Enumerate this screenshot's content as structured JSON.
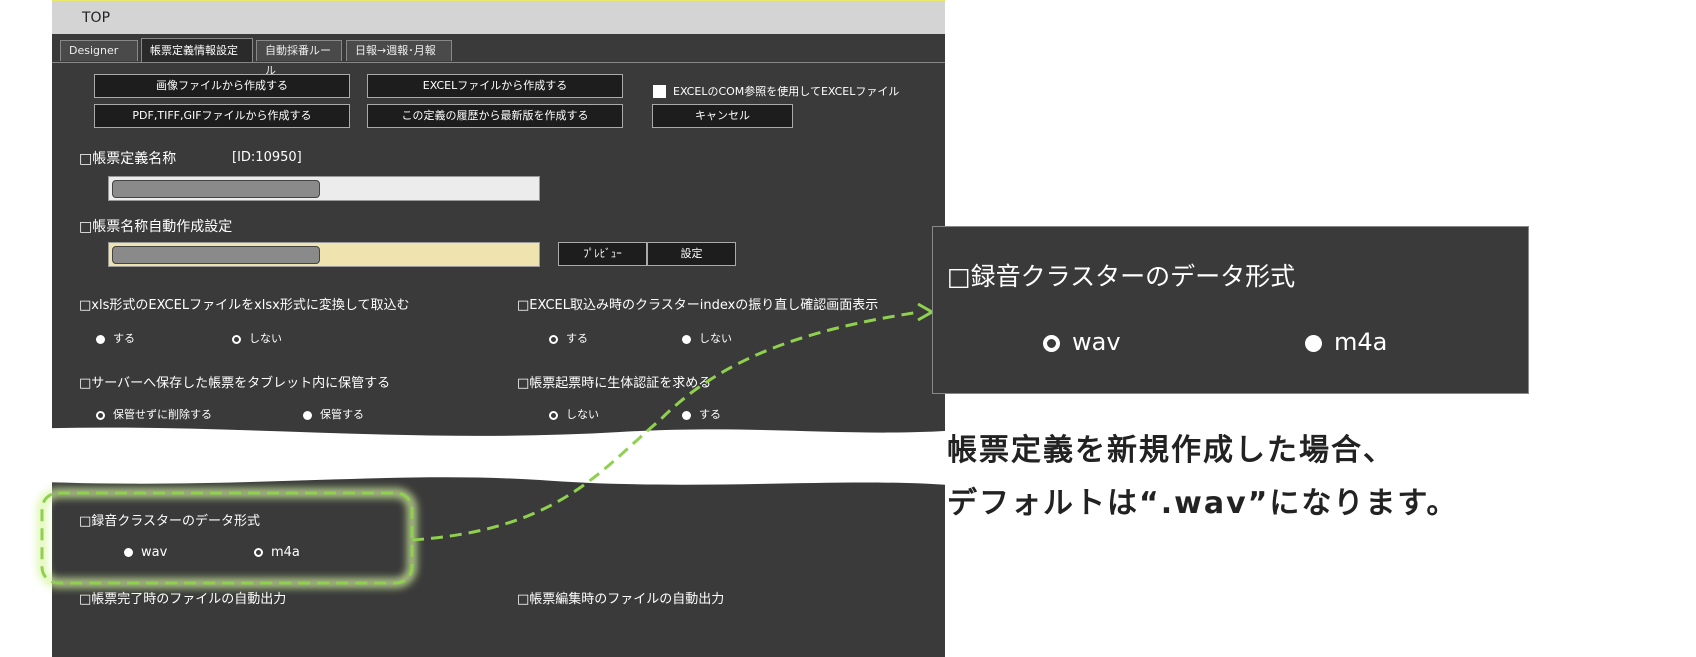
{
  "window": {
    "title": "TOP"
  },
  "tabs": [
    {
      "label": "Designer",
      "active": false
    },
    {
      "label": "帳票定義情報設定",
      "active": true
    },
    {
      "label": "自動採番ルール",
      "active": false
    },
    {
      "label": "日報→週報･月報",
      "active": false
    }
  ],
  "toolbar": {
    "create_from_image": "画像ファイルから作成する",
    "create_from_excel": "EXCELファイルから作成する",
    "com_checkbox_label": "EXCELのCOM参照を使用してEXCELファイル",
    "create_from_pdf": "PDF,TIFF,GIFファイルから作成する",
    "create_from_history": "この定義の履歴から最新版を作成する",
    "cancel": "キャンセル"
  },
  "form_name": {
    "label": "□帳票定義名称",
    "id_text": "[ID:10950]"
  },
  "auto_name": {
    "label": "□帳票名称自動作成設定",
    "preview": "ﾌﾟﾚﾋﾞｭｰ",
    "settings": "設定"
  },
  "xls_convert": {
    "label": "□xls形式のEXCELファイルをxlsx形式に変換して取込む",
    "opt_yes": "する",
    "opt_no": "しない",
    "selected": "しない"
  },
  "cluster_index": {
    "label": "□EXCEL取込み時のクラスターindexの振り直し確認画面表示",
    "opt_yes": "する",
    "opt_no": "しない",
    "selected": "する"
  },
  "tablet_keep": {
    "label": "□サーバーへ保存した帳票をタブレット内に保管する",
    "opt_delete": "保管せずに削除する",
    "opt_keep": "保管する",
    "selected": "保管せずに削除する"
  },
  "bio_auth": {
    "label": "□帳票起票時に生体認証を求める",
    "opt_no": "しない",
    "opt_yes": "する",
    "selected": "しない"
  },
  "audio_format": {
    "label": "□録音クラスターのデータ形式",
    "opt_wav": "wav",
    "opt_m4a": "m4a",
    "selected": "m4a"
  },
  "auto_output_done": {
    "label": "□帳票完了時のファイルの自動出力"
  },
  "auto_output_edit": {
    "label": "□帳票編集時のファイルの自動出力"
  },
  "zoom": {
    "label": "□録音クラスターのデータ形式",
    "opt_wav": "wav",
    "opt_m4a": "m4a",
    "selected": "wav"
  },
  "annotation": {
    "line1": "帳票定義を新規作成した場合、",
    "line2": "デフォルトは“.wav”になります。"
  },
  "colors": {
    "panel": "#3a3a3a",
    "highlight": "#8fd14f",
    "name_field": "#ececec",
    "auto_name_field": "#efe3b0"
  }
}
